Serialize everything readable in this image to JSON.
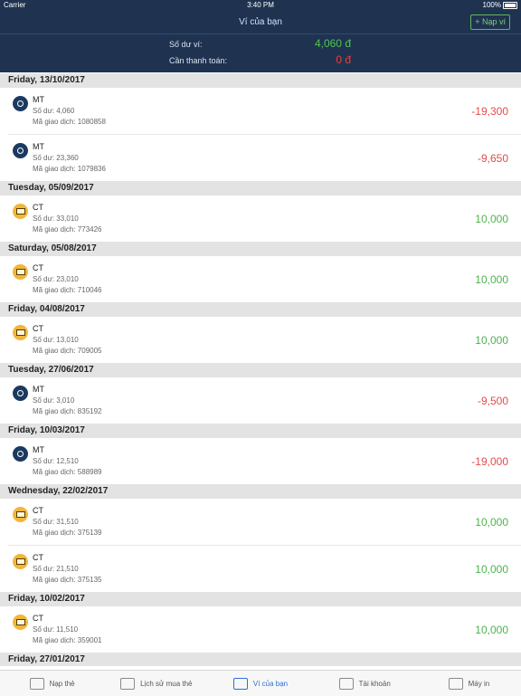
{
  "status": {
    "carrier": "Carrier",
    "time": "3:40 PM",
    "battery": "100%"
  },
  "nav": {
    "title": "Ví của bạn",
    "topup_label": "+ Nạp ví"
  },
  "balance": {
    "wallet_label": "Số dư ví:",
    "wallet_value": "4,060 đ",
    "due_label": "Cần thanh toán:",
    "due_value": "0 đ"
  },
  "groups": [
    {
      "date": "Friday, 13/10/2017",
      "items": [
        {
          "type": "MT",
          "balance": "Số dư: 4,060",
          "code": "Mã giao dịch: 1080858",
          "amount": "-19,300",
          "sign": "neg"
        },
        {
          "type": "MT",
          "balance": "Số dư: 23,360",
          "code": "Mã giao dịch: 1079836",
          "amount": "-9,650",
          "sign": "neg"
        }
      ]
    },
    {
      "date": "Tuesday, 05/09/2017",
      "items": [
        {
          "type": "CT",
          "balance": "Số dư: 33,010",
          "code": "Mã giao dịch: 773426",
          "amount": "10,000",
          "sign": "pos"
        }
      ]
    },
    {
      "date": "Saturday, 05/08/2017",
      "items": [
        {
          "type": "CT",
          "balance": "Số dư: 23,010",
          "code": "Mã giao dịch: 710046",
          "amount": "10,000",
          "sign": "pos"
        }
      ]
    },
    {
      "date": "Friday, 04/08/2017",
      "items": [
        {
          "type": "CT",
          "balance": "Số dư: 13,010",
          "code": "Mã giao dịch: 709005",
          "amount": "10,000",
          "sign": "pos"
        }
      ]
    },
    {
      "date": "Tuesday, 27/06/2017",
      "items": [
        {
          "type": "MT",
          "balance": "Số dư: 3,010",
          "code": "Mã giao dịch: 835192",
          "amount": "-9,500",
          "sign": "neg"
        }
      ]
    },
    {
      "date": "Friday, 10/03/2017",
      "items": [
        {
          "type": "MT",
          "balance": "Số dư: 12,510",
          "code": "Mã giao dịch: 588989",
          "amount": "-19,000",
          "sign": "neg"
        }
      ]
    },
    {
      "date": "Wednesday, 22/02/2017",
      "items": [
        {
          "type": "CT",
          "balance": "Số dư: 31,510",
          "code": "Mã giao dịch: 375139",
          "amount": "10,000",
          "sign": "pos"
        },
        {
          "type": "CT",
          "balance": "Số dư: 21,510",
          "code": "Mã giao dịch: 375135",
          "amount": "10,000",
          "sign": "pos"
        }
      ]
    },
    {
      "date": "Friday, 10/02/2017",
      "items": [
        {
          "type": "CT",
          "balance": "Số dư: 11,510",
          "code": "Mã giao dịch: 359001",
          "amount": "10,000",
          "sign": "pos"
        }
      ]
    },
    {
      "date": "Friday, 27/01/2017",
      "items": []
    }
  ],
  "tabs": [
    {
      "label": "Nạp thẻ",
      "icon": "card-icon",
      "active": false
    },
    {
      "label": "Lịch sử mua thẻ",
      "icon": "calendar-icon",
      "active": false
    },
    {
      "label": "Ví của bạn",
      "icon": "wallet-icon",
      "active": true
    },
    {
      "label": "Tài khoản",
      "icon": "user-icon",
      "active": false
    },
    {
      "label": "Máy in",
      "icon": "printer-icon",
      "active": false
    }
  ]
}
